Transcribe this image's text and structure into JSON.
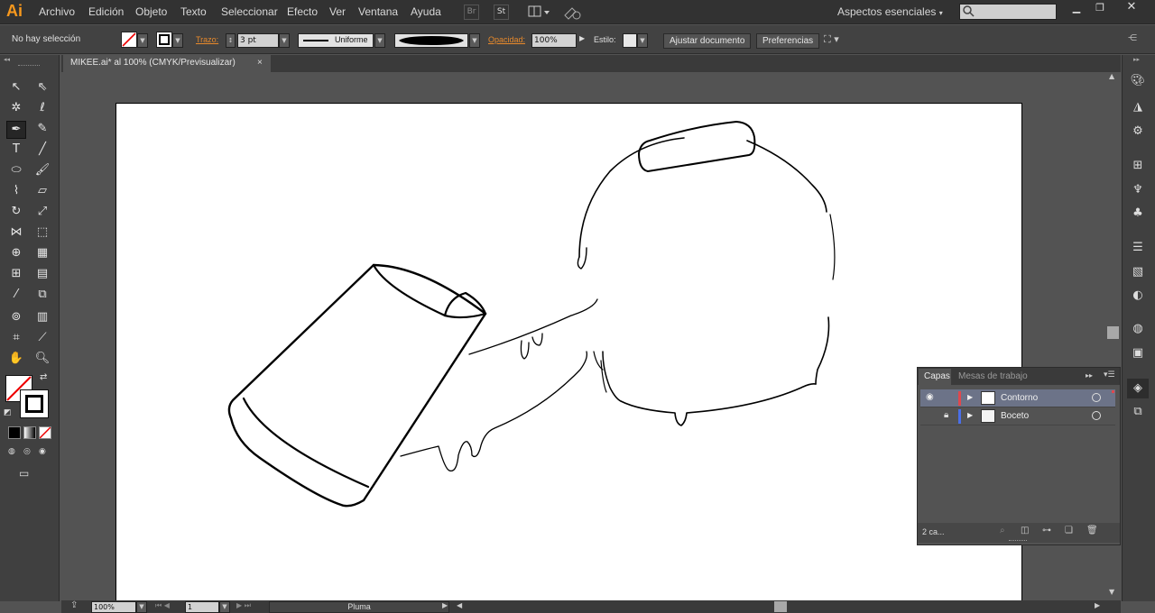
{
  "app": {
    "logo": "Ai"
  },
  "menu": [
    "Archivo",
    "Edición",
    "Objeto",
    "Texto",
    "Seleccionar",
    "Efecto",
    "Ver",
    "Ventana",
    "Ayuda"
  ],
  "topbar": {
    "bridge_label": "Br",
    "stock_label": "St",
    "workspace": "Aspectos esenciales",
    "search_placeholder": ""
  },
  "control": {
    "selection": "No hay selección",
    "stroke_label": "Trazo:",
    "stroke_value": "3 pt",
    "profile_label": "Uniforme",
    "opacity_label": "Opacidad:",
    "opacity_value": "100%",
    "style_label": "Estilo:",
    "fit_button": "Ajustar documento",
    "prefs_button": "Preferencias"
  },
  "document": {
    "tab_title": "MIKEE.ai* al 100% (CMYK/Previsualizar)",
    "close": "×"
  },
  "status": {
    "zoom": "100%",
    "artboard_num": "1",
    "tool_name": "Pluma"
  },
  "layers": {
    "tab_layers": "Capas",
    "tab_artboards": "Mesas de trabajo",
    "rows": [
      {
        "name": "Contorno",
        "color": "#e0484d",
        "selected": true,
        "locked": false,
        "visible": true
      },
      {
        "name": "Boceto",
        "color": "#4a6fe8",
        "selected": false,
        "locked": true,
        "visible": false
      }
    ],
    "count": "2 ca..."
  },
  "colors": {
    "accent": "#f7981d",
    "label_orange": "#e98a2b"
  }
}
